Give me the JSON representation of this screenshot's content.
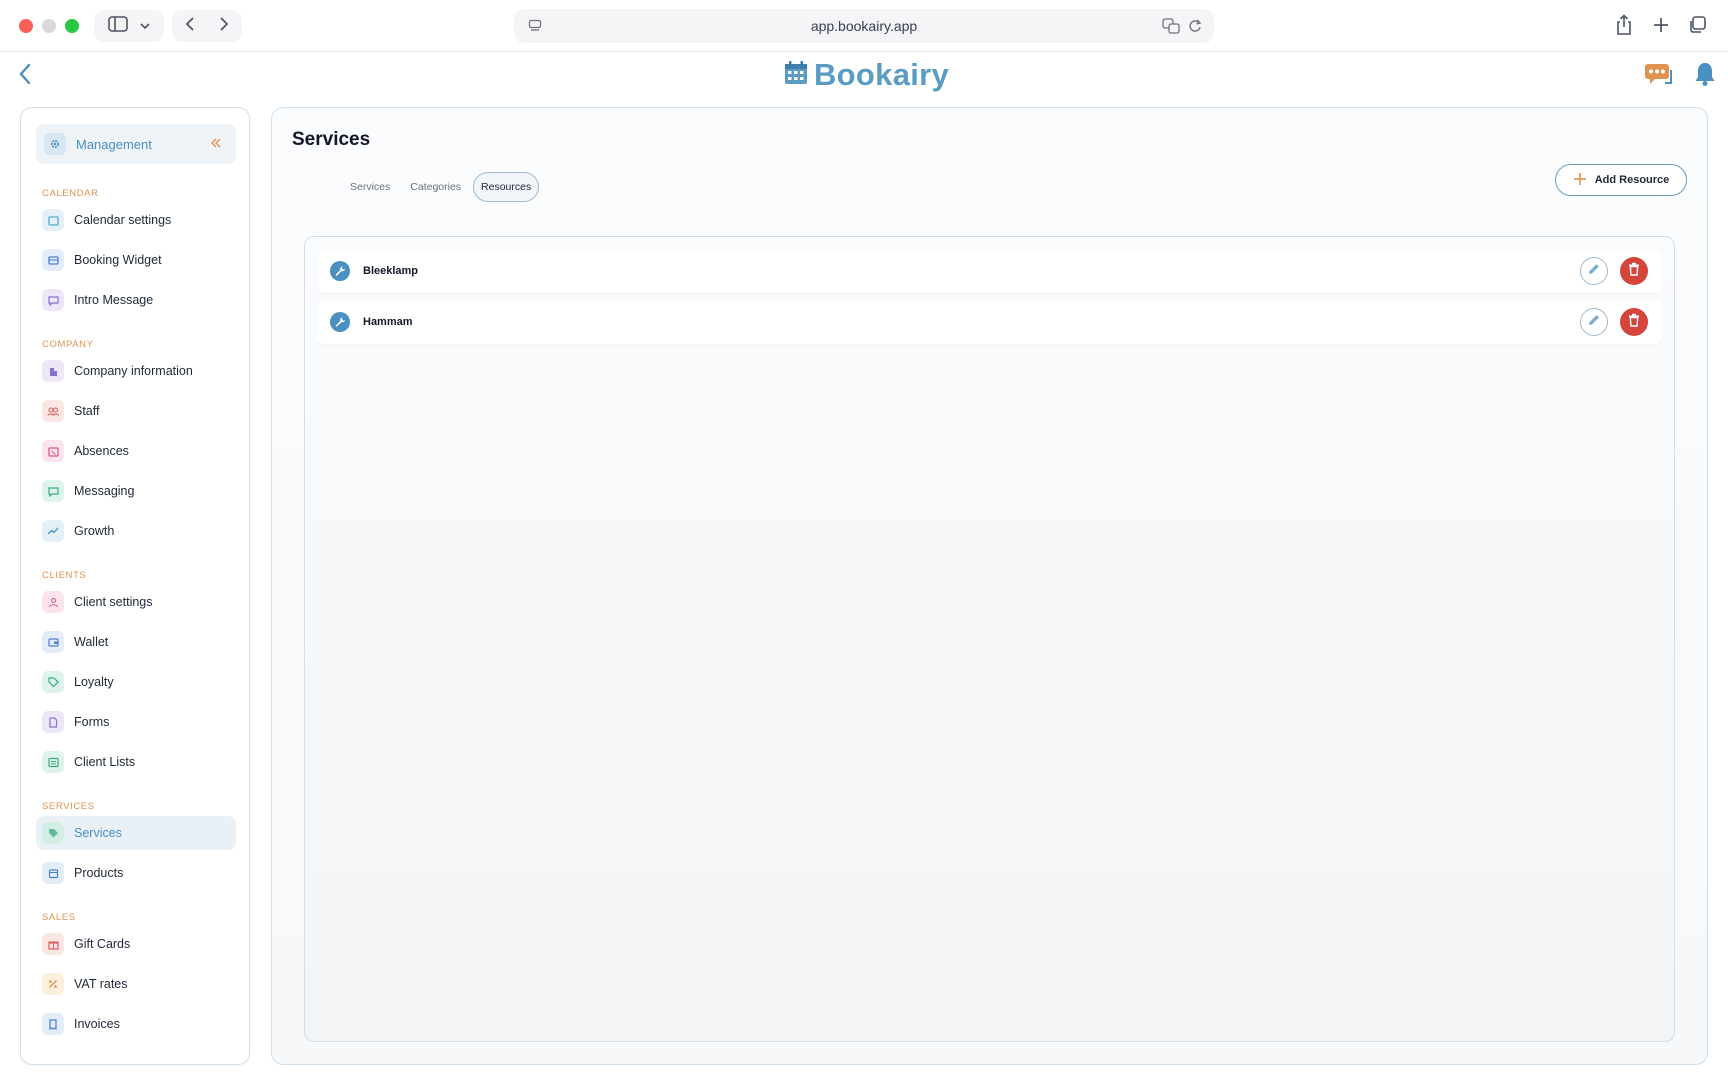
{
  "browser": {
    "url": "app.bookairy.app",
    "traffic_colors": [
      "#ff5f57",
      "#d9d9d9",
      "#28c840"
    ]
  },
  "app": {
    "logo_text": "Bookairy",
    "brand_color": "#5b9cc4",
    "accent_color": "#e0934f"
  },
  "sidebar": {
    "header_label": "Management",
    "sections": {
      "calendar": "CALENDAR",
      "company": "COMPANY",
      "clients": "CLIENTS",
      "services": "SERVICES",
      "sales": "SALES"
    },
    "items": {
      "calendar_settings": "Calendar settings",
      "booking_widget": "Booking Widget",
      "intro_message": "Intro Message",
      "company_information": "Company information",
      "staff": "Staff",
      "absences": "Absences",
      "messaging": "Messaging",
      "growth": "Growth",
      "client_settings": "Client settings",
      "wallet": "Wallet",
      "loyalty": "Loyalty",
      "forms": "Forms",
      "client_lists": "Client Lists",
      "services": "Services",
      "products": "Products",
      "gift_cards": "Gift Cards",
      "vat_rates": "VAT rates",
      "invoices": "Invoices"
    },
    "active_item": "services"
  },
  "main": {
    "title": "Services",
    "tabs": [
      "Services",
      "Categories",
      "Resources"
    ],
    "active_tab": "Resources",
    "add_button_label": "Add Resource",
    "resources": [
      "Bleeklamp",
      "Hammam"
    ]
  }
}
